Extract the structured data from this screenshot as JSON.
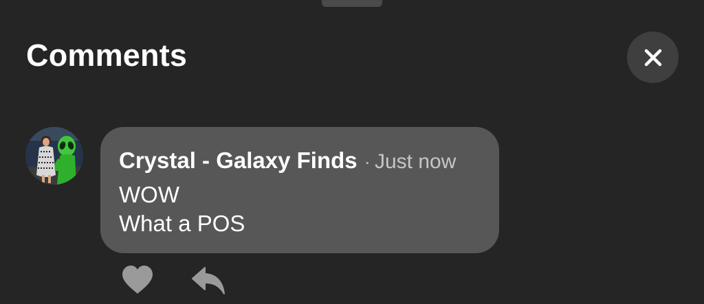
{
  "header": {
    "title": "Comments",
    "close_icon": "close-icon"
  },
  "comment": {
    "author": "Crystal - Galaxy Finds",
    "separator": "·",
    "timestamp": "Just now",
    "lines": [
      "WOW",
      "What a POS"
    ],
    "avatar_icon": "avatar"
  },
  "actions": {
    "like_icon": "heart-icon",
    "reply_icon": "reply-icon"
  },
  "colors": {
    "background": "#252525",
    "bubble": "#575757",
    "close_button": "#3f3f3f",
    "icon_gray": "#9a9a9a"
  }
}
